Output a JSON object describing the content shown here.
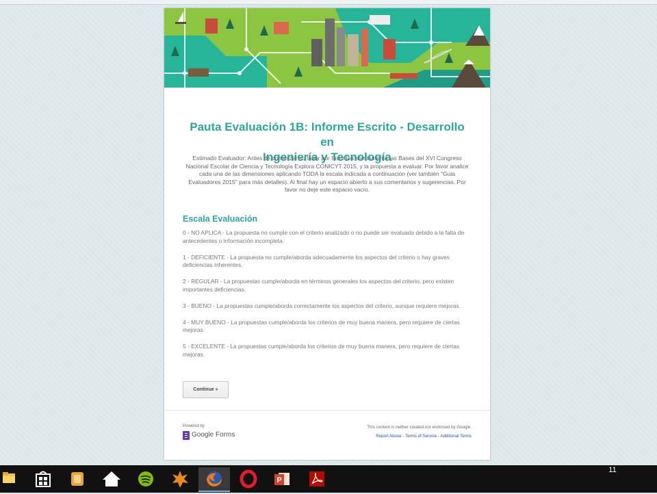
{
  "form": {
    "title_line1": "Pauta Evaluación 1B: Informe Escrito - Desarrollo en",
    "title_line2": "Ingeniería y Tecnología",
    "description": "Estimado Evaluador: Antes de comenzar su labor por favor lea atentamente las Bases del XVI Congreso Nacional Escolar de Ciencia y Tecnología Explora CONICYT 2015, y la propuesta a evaluar. Por favor analice cada una de las dimensiones aplicando TODA la escala indicada a continuación (ver también \"Guia Evaluadores 2015\" para más detalles). Al final hay un espacio abierto a sus comentarios y sugerencias. Por favor no deje este espacio vacío.",
    "section_title": "Escala Evaluación",
    "scale": [
      "0 - NO APLICA - La propuesta no cumple con el criterio analizado o no puede ser evaluada debido a la falta de antecedentes o información incompleta.",
      "1 - DEFICIENTE - La propuesta no cumple/aborda adecuadamente los aspectos del criterio o hay graves deficiencias inherentes.",
      "2 - REGULAR - La propuestas cumple/aborda en términos generales los aspectos del criterio, pero existen importantes deficiencias.",
      "3 - BUENO - La propuestas cumple/aborda correctamente los aspectos del criterio, aunque requiere  mejoras.",
      "4 - MUY BUENO - La propuestas cumple/aborda los criterios de muy buena manera, pero requiere de ciertas mejoras.",
      "5 - EXCELENTE - La propuestas cumple/aborda los criterios de muy buena manera, pero requiere de ciertas mejoras."
    ],
    "continue_label": "Continue »"
  },
  "footer": {
    "powered_by": "Powered by",
    "google_forms": "Google Forms",
    "disclaimer": "This content is neither created nor endorsed by Google.",
    "report_abuse": "Report Abuse",
    "terms": "Terms of Service",
    "additional_terms": "Additional Terms",
    "separator": " - "
  },
  "taskbar": {
    "page_number": "11",
    "icons": [
      "file-explorer-icon",
      "store-icon",
      "notes-app-icon",
      "home-icon",
      "spotify-icon",
      "burst-app-icon",
      "firefox-icon",
      "opera-icon",
      "powerpoint-icon",
      "acrobat-pdf-icon"
    ]
  },
  "colors": {
    "accent": "#2aa7a0",
    "link": "#1155cc",
    "banner_green": "#8dc63f",
    "taskbar": "#111111"
  }
}
